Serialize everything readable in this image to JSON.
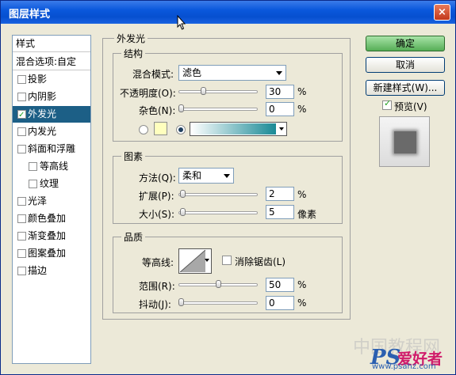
{
  "title": "图层样式",
  "close_icon": "×",
  "left_panel": {
    "header": "样式",
    "blend_options": "混合选项:自定",
    "items": [
      {
        "label": "投影",
        "checked": false,
        "indent": false,
        "selected": false
      },
      {
        "label": "内阴影",
        "checked": false,
        "indent": false,
        "selected": false
      },
      {
        "label": "外发光",
        "checked": true,
        "indent": false,
        "selected": true
      },
      {
        "label": "内发光",
        "checked": false,
        "indent": false,
        "selected": false
      },
      {
        "label": "斜面和浮雕",
        "checked": false,
        "indent": false,
        "selected": false
      },
      {
        "label": "等高线",
        "checked": false,
        "indent": true,
        "selected": false
      },
      {
        "label": "纹理",
        "checked": false,
        "indent": true,
        "selected": false
      },
      {
        "label": "光泽",
        "checked": false,
        "indent": false,
        "selected": false
      },
      {
        "label": "颜色叠加",
        "checked": false,
        "indent": false,
        "selected": false
      },
      {
        "label": "渐变叠加",
        "checked": false,
        "indent": false,
        "selected": false
      },
      {
        "label": "图案叠加",
        "checked": false,
        "indent": false,
        "selected": false
      },
      {
        "label": "描边",
        "checked": false,
        "indent": false,
        "selected": false
      }
    ]
  },
  "outer_glow": {
    "title": "外发光",
    "structure": {
      "title": "结构",
      "blend_mode_label": "混合模式:",
      "blend_mode_value": "滤色",
      "opacity_label": "不透明度(O):",
      "opacity_value": "30",
      "opacity_unit": "%",
      "opacity_level": 0.3,
      "noise_label": "杂色(N):",
      "noise_value": "0",
      "noise_unit": "%",
      "noise_level": 0.0,
      "solid_color": "#ffffbe",
      "gradient_start": "#ffffff",
      "gradient_end": "#1a8a96"
    },
    "elements": {
      "title": "图素",
      "method_label": "方法(Q):",
      "method_value": "柔和",
      "spread_label": "扩展(P):",
      "spread_value": "2",
      "spread_unit": "%",
      "spread_level": 0.02,
      "size_label": "大小(S):",
      "size_value": "5",
      "size_unit": "像素",
      "size_level": 0.02
    },
    "quality": {
      "title": "品质",
      "contour_label": "等高线:",
      "antialias_label": "消除锯齿(L)",
      "antialias_checked": false,
      "range_label": "范围(R):",
      "range_value": "50",
      "range_unit": "%",
      "range_level": 0.5,
      "jitter_label": "抖动(J):",
      "jitter_value": "0",
      "jitter_unit": "%",
      "jitter_level": 0.0
    }
  },
  "buttons": {
    "ok": "确定",
    "cancel": "取消",
    "new_style": "新建样式(W)...",
    "preview_label": "预览(V)",
    "preview_checked": true
  },
  "watermark": {
    "line1": "中国教程网",
    "ps": "PS",
    "brand": "爱好者",
    "url": "www.psahz.com"
  },
  "colors": {
    "title_bar": "#0a58dc",
    "selection": "#1c5f86",
    "ok_button": "#56ad56"
  }
}
